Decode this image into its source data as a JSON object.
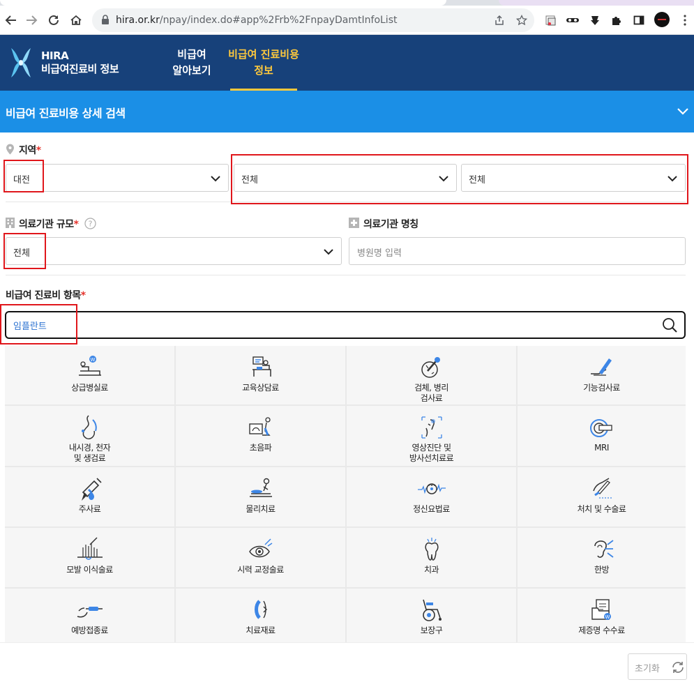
{
  "browser": {
    "url_host": "hira.or.kr",
    "url_path": "/npay/index.do#app%2Frb%2FnpayDamtInfoList"
  },
  "header": {
    "logo_line1": "HIRA",
    "logo_line2": "비급여진료비 정보",
    "nav": [
      {
        "line1": "비급여",
        "line2": "알아보기",
        "active": false
      },
      {
        "line1": "비급여 진료비용",
        "line2": "정보",
        "active": true
      }
    ]
  },
  "panel": {
    "title": "비급여 진료비용 상세 검색"
  },
  "form": {
    "region_label": "지역",
    "required_mark": "*",
    "region_select_1": "대전",
    "region_select_2": "전체",
    "region_select_3": "전체",
    "scale_label": "의료기관 규모",
    "scale_select": "전체",
    "name_label": "의료기관 명칭",
    "name_placeholder": "병원명 입력",
    "item_label": "비급여 진료비 항목",
    "item_value": "임플란트"
  },
  "categories": [
    {
      "line1": "상급병실료",
      "line2": "",
      "icon": "bed-icon"
    },
    {
      "line1": "교육상담료",
      "line2": "",
      "icon": "consultation-icon"
    },
    {
      "line1": "검체, 병리",
      "line2": "검사료",
      "icon": "microscope-icon"
    },
    {
      "line1": "기능검사료",
      "line2": "",
      "icon": "function-test-icon"
    },
    {
      "line1": "내시경, 천자",
      "line2": "및 생검료",
      "icon": "endoscope-icon"
    },
    {
      "line1": "초음파",
      "line2": "",
      "icon": "ultrasound-icon"
    },
    {
      "line1": "영상진단 및",
      "line2": "방사선치료료",
      "icon": "xray-icon"
    },
    {
      "line1": "MRI",
      "line2": "",
      "icon": "mri-icon"
    },
    {
      "line1": "주사료",
      "line2": "",
      "icon": "syringe-icon"
    },
    {
      "line1": "물리치료",
      "line2": "",
      "icon": "physical-therapy-icon"
    },
    {
      "line1": "정신요법료",
      "line2": "",
      "icon": "brain-wave-icon"
    },
    {
      "line1": "처치 및 수술료",
      "line2": "",
      "icon": "surgery-icon"
    },
    {
      "line1": "모발 이식술료",
      "line2": "",
      "icon": "hair-transplant-icon"
    },
    {
      "line1": "시력 교정술료",
      "line2": "",
      "icon": "eye-icon"
    },
    {
      "line1": "치과",
      "line2": "",
      "icon": "tooth-icon"
    },
    {
      "line1": "한방",
      "line2": "",
      "icon": "acupuncture-ear-icon"
    },
    {
      "line1": "예방접종료",
      "line2": "",
      "icon": "vaccine-icon"
    },
    {
      "line1": "치료재료",
      "line2": "",
      "icon": "lens-icon"
    },
    {
      "line1": "보장구",
      "line2": "",
      "icon": "wheelchair-icon"
    },
    {
      "line1": "제증명 수수료",
      "line2": "",
      "icon": "certificate-icon"
    }
  ],
  "bottom": {
    "reset_label": "초기화"
  },
  "colors": {
    "header_bg": "#17417a",
    "panel_bg": "#1b8fe6",
    "active_nav": "#ffc93c",
    "required": "#e5342d",
    "highlight_box": "#e0161b",
    "icon_accent": "#3d86e6"
  }
}
